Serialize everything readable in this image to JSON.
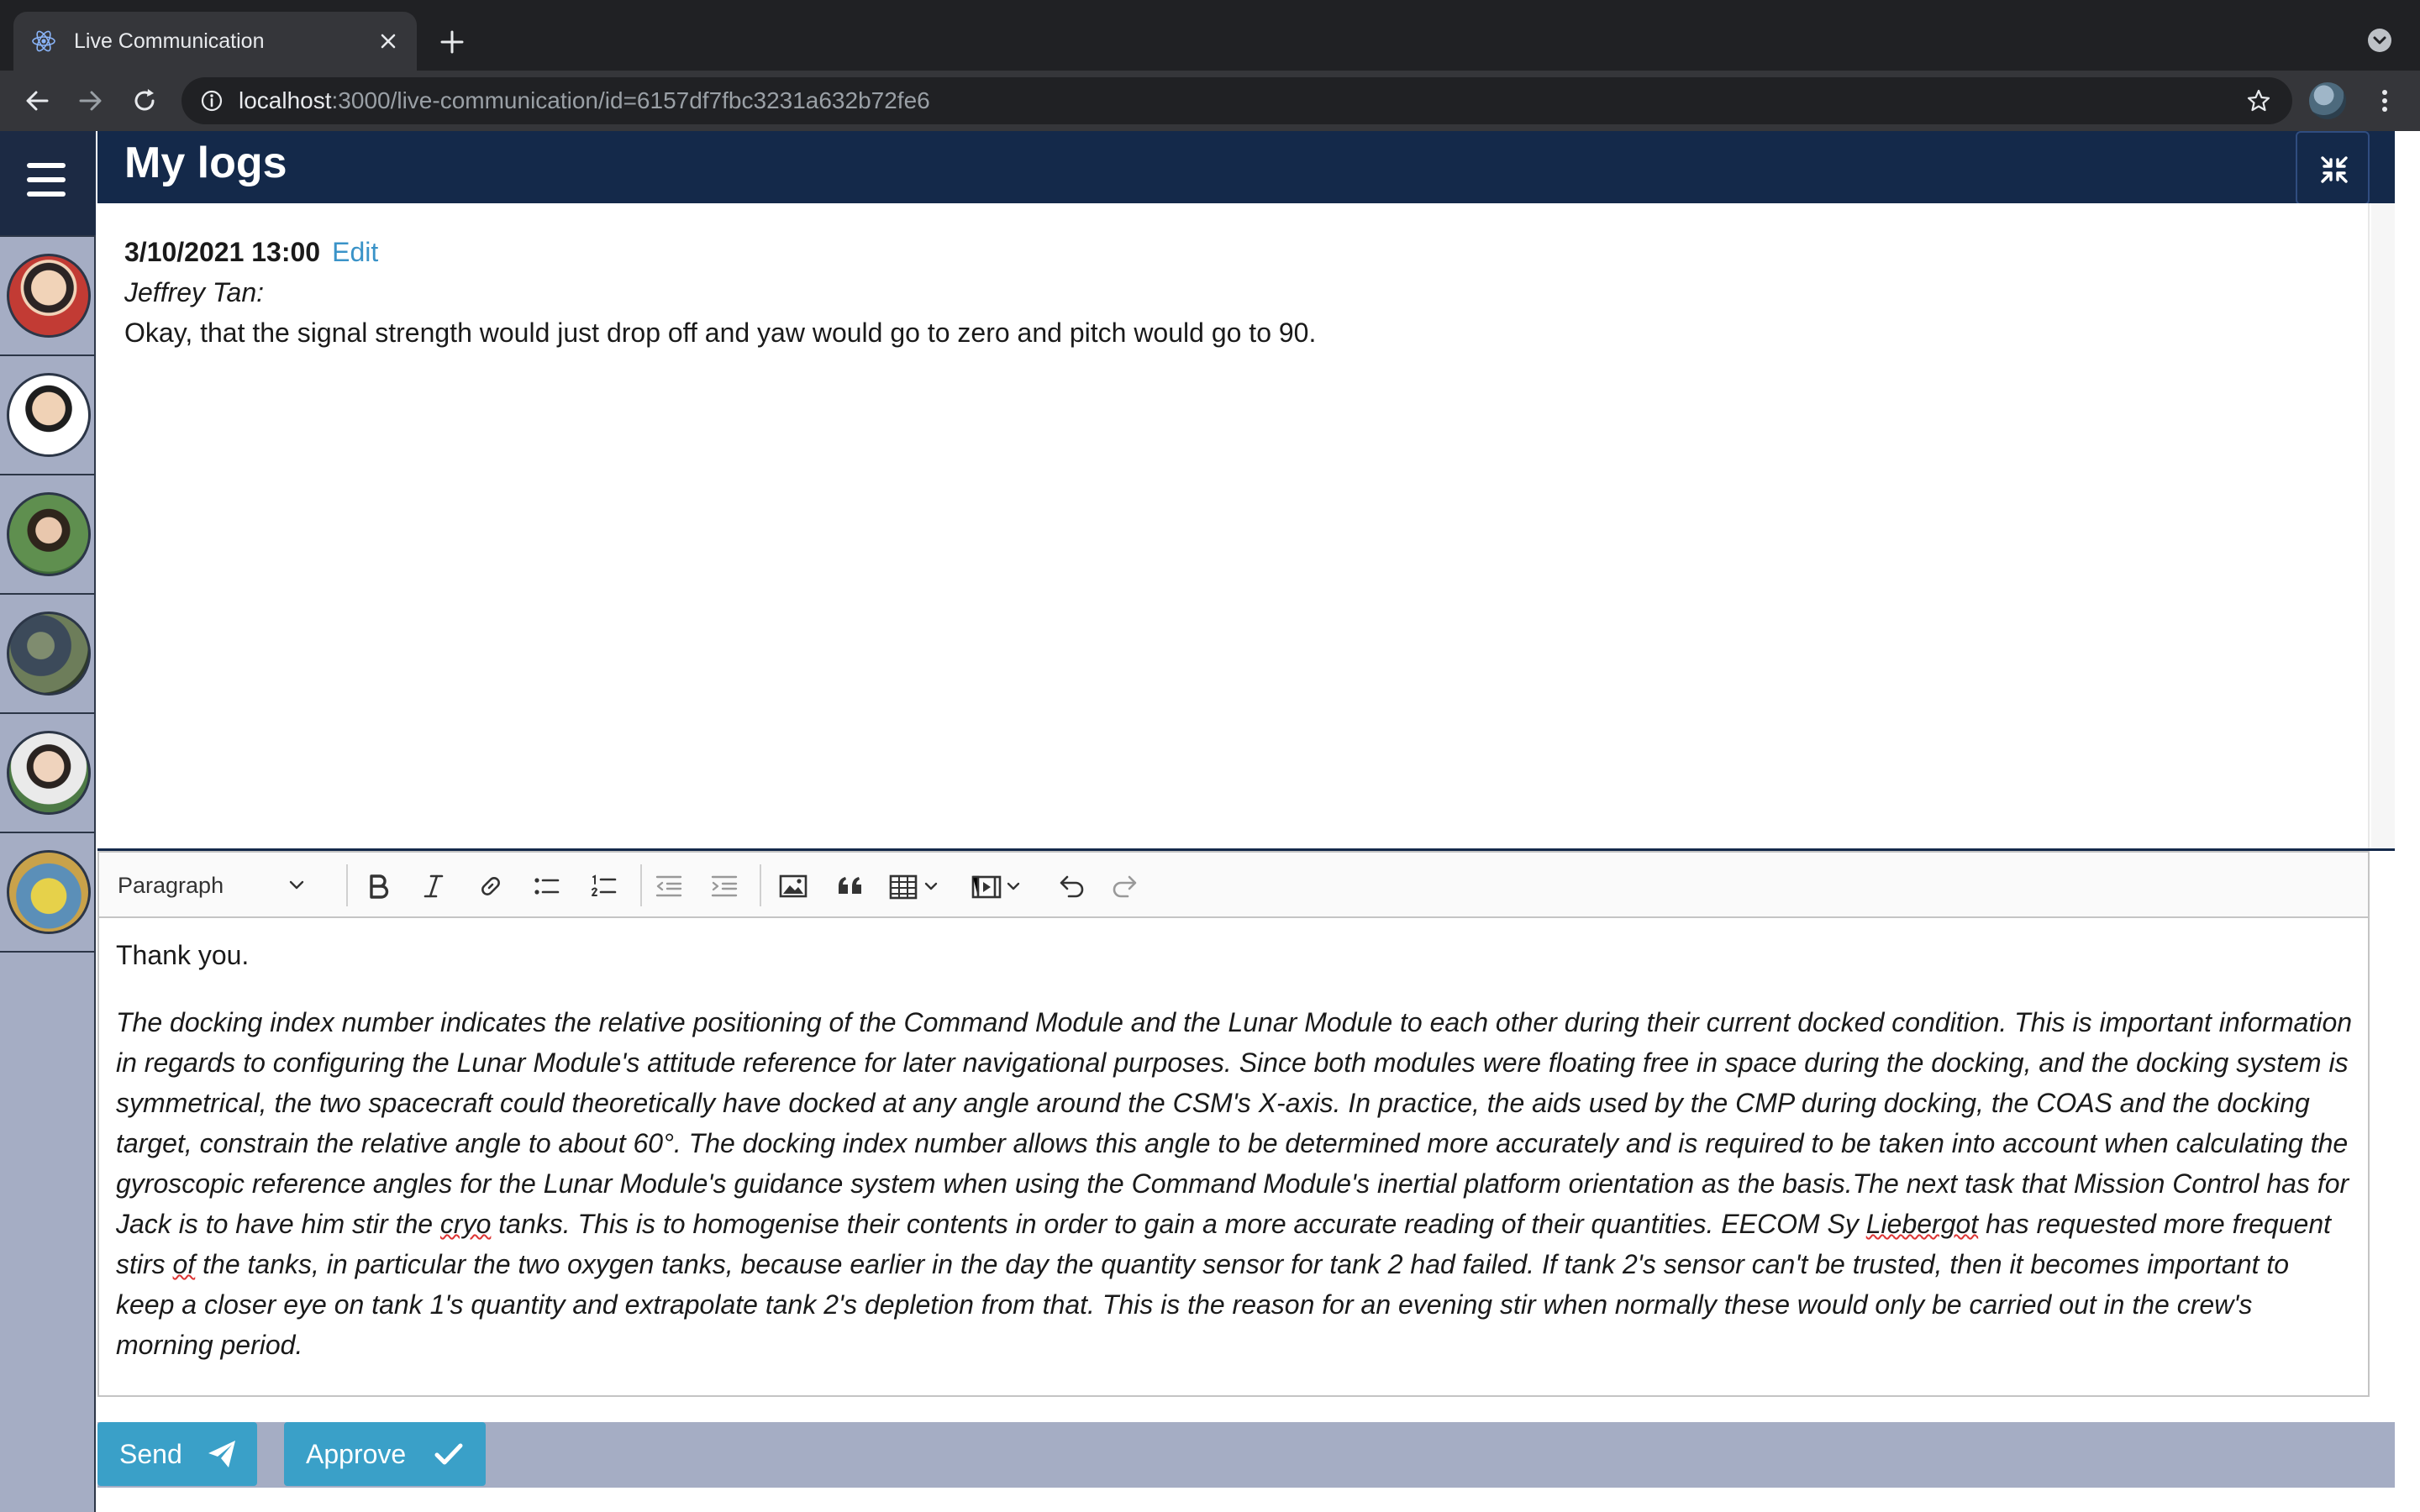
{
  "browser": {
    "tab_title": "Live Communication",
    "url_host": "localhost",
    "url_path": ":3000/live-communication/id=6157df7fbc3231a632b72fe6"
  },
  "header": {
    "title": "My logs"
  },
  "log": {
    "datetime": "3/10/2021 13:00",
    "edit_label": "Edit",
    "author": "Jeffrey Tan:",
    "message": "Okay, that the signal strength would just drop off and yaw would go to zero and pitch would go to 90."
  },
  "editor": {
    "format_label": "Paragraph",
    "paragraph1": "Thank you.",
    "paragraph2_a": "The docking index number indicates the relative positioning of the Command Module and the Lunar Module to each other during their current docked condition. This is important information in regards to configuring the Lunar Module's attitude reference for later navigational purposes. Since both modules were floating free in space during the docking, and the docking system is symmetrical, the two spacecraft could theoretically have docked at any angle around the CSM's X-axis. In practice, the aids used by the CMP during docking, the COAS and the docking target, constrain the relative angle to about 60°. The docking index number allows this angle to be determined more accurately and is required to be taken into account when calculating the gyroscopic reference angles for the Lunar Module's guidance system when using the Command Module's inertial platform orientation as the basis.The next task that Mission Control has for Jack is to have him stir the ",
    "spell1": "cryo",
    "paragraph2_b": " tanks. This is to homogenise their contents in order to gain a more accurate reading of their quantities. EECOM Sy ",
    "spell2": "Liebergot",
    "paragraph2_c": " has requested more frequent stirs ",
    "spell3": "of",
    "paragraph2_d": " the tanks, in particular the two oxygen tanks, because earlier in the day the quantity sensor for tank 2 had failed. If tank 2's sensor can't be trusted, then it becomes important to keep a closer eye on tank 1's quantity and extrapolate tank 2's depletion from that. This is the reason for an evening stir when normally these would only be carried out in the crew's morning period."
  },
  "actions": {
    "send_label": "Send",
    "approve_label": "Approve"
  },
  "colors": {
    "header_bg": "#14294a",
    "accent_button": "#3aa0c8",
    "sidebar_bg": "#a5adc4",
    "edit_link": "#3a93c8"
  },
  "icons": [
    "react-icon",
    "close-icon",
    "plus-icon",
    "back-arrow-icon",
    "forward-arrow-icon",
    "reload-icon",
    "info-icon",
    "star-icon",
    "kebab-icon",
    "hamburger-icon",
    "collapse-icon",
    "bold-icon",
    "italic-icon",
    "link-icon",
    "bulleted-list-icon",
    "numbered-list-icon",
    "outdent-icon",
    "indent-icon",
    "image-icon",
    "quote-icon",
    "table-icon",
    "media-icon",
    "undo-icon",
    "redo-icon",
    "paper-plane-icon",
    "check-icon"
  ]
}
